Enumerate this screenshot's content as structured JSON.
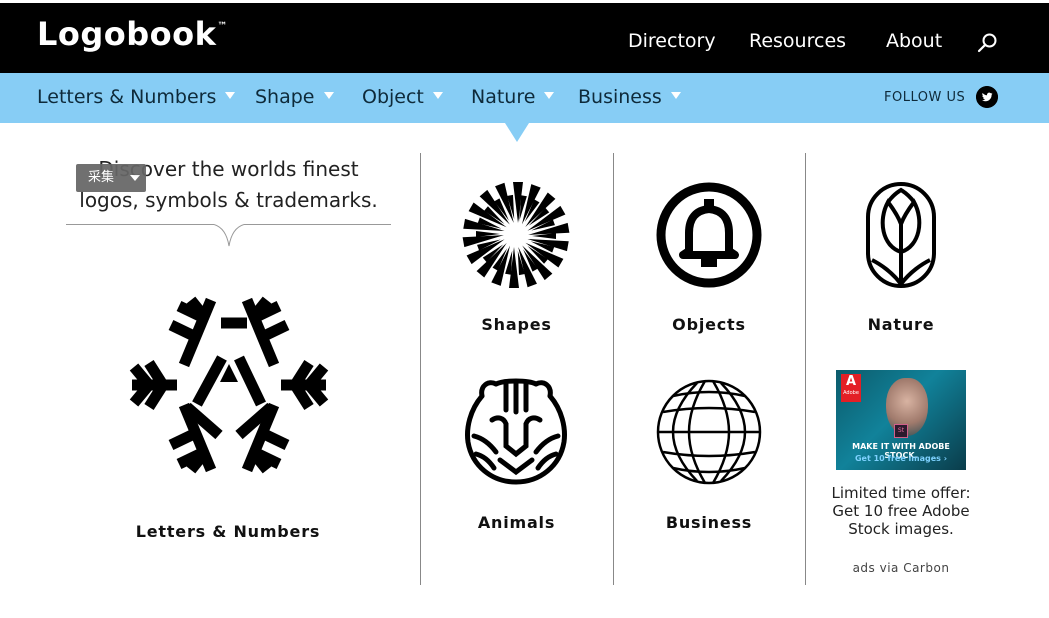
{
  "header": {
    "logo_text": "Logobook",
    "logo_tm": "™",
    "nav": [
      "Directory",
      "Resources",
      "About"
    ]
  },
  "subnav": {
    "categories": [
      "Letters & Numbers",
      "Shape",
      "Object",
      "Nature",
      "Business"
    ],
    "follow_label": "FOLLOW US"
  },
  "intro": {
    "tagline_line1": "Discover the worlds finest",
    "tagline_line2": "logos, symbols & trademarks.",
    "collect_label": "采集"
  },
  "tiles": {
    "letters_numbers": "Letters & Numbers",
    "shapes": "Shapes",
    "objects": "Objects",
    "nature": "Nature",
    "animals": "Animals",
    "business": "Business"
  },
  "ad": {
    "brand": "Adobe",
    "brand_mark": "A",
    "product_mark": "St",
    "banner_line1": "MAKE IT WITH ADOBE STOCK.",
    "banner_line2": "Get 10 free images ›",
    "text": "Limited time offer: Get 10 free Adobe Stock images.",
    "via": "ads via Carbon"
  },
  "colors": {
    "header_bg": "#000000",
    "subnav_bg": "#87cdf5",
    "text": "#111111"
  },
  "icons": [
    "search-icon",
    "twitter-icon",
    "chevron-down-icon",
    "snowflake-a-logo",
    "sunburst-logo",
    "bell-logo",
    "tulip-logo",
    "tiger-logo",
    "globe-logo"
  ]
}
